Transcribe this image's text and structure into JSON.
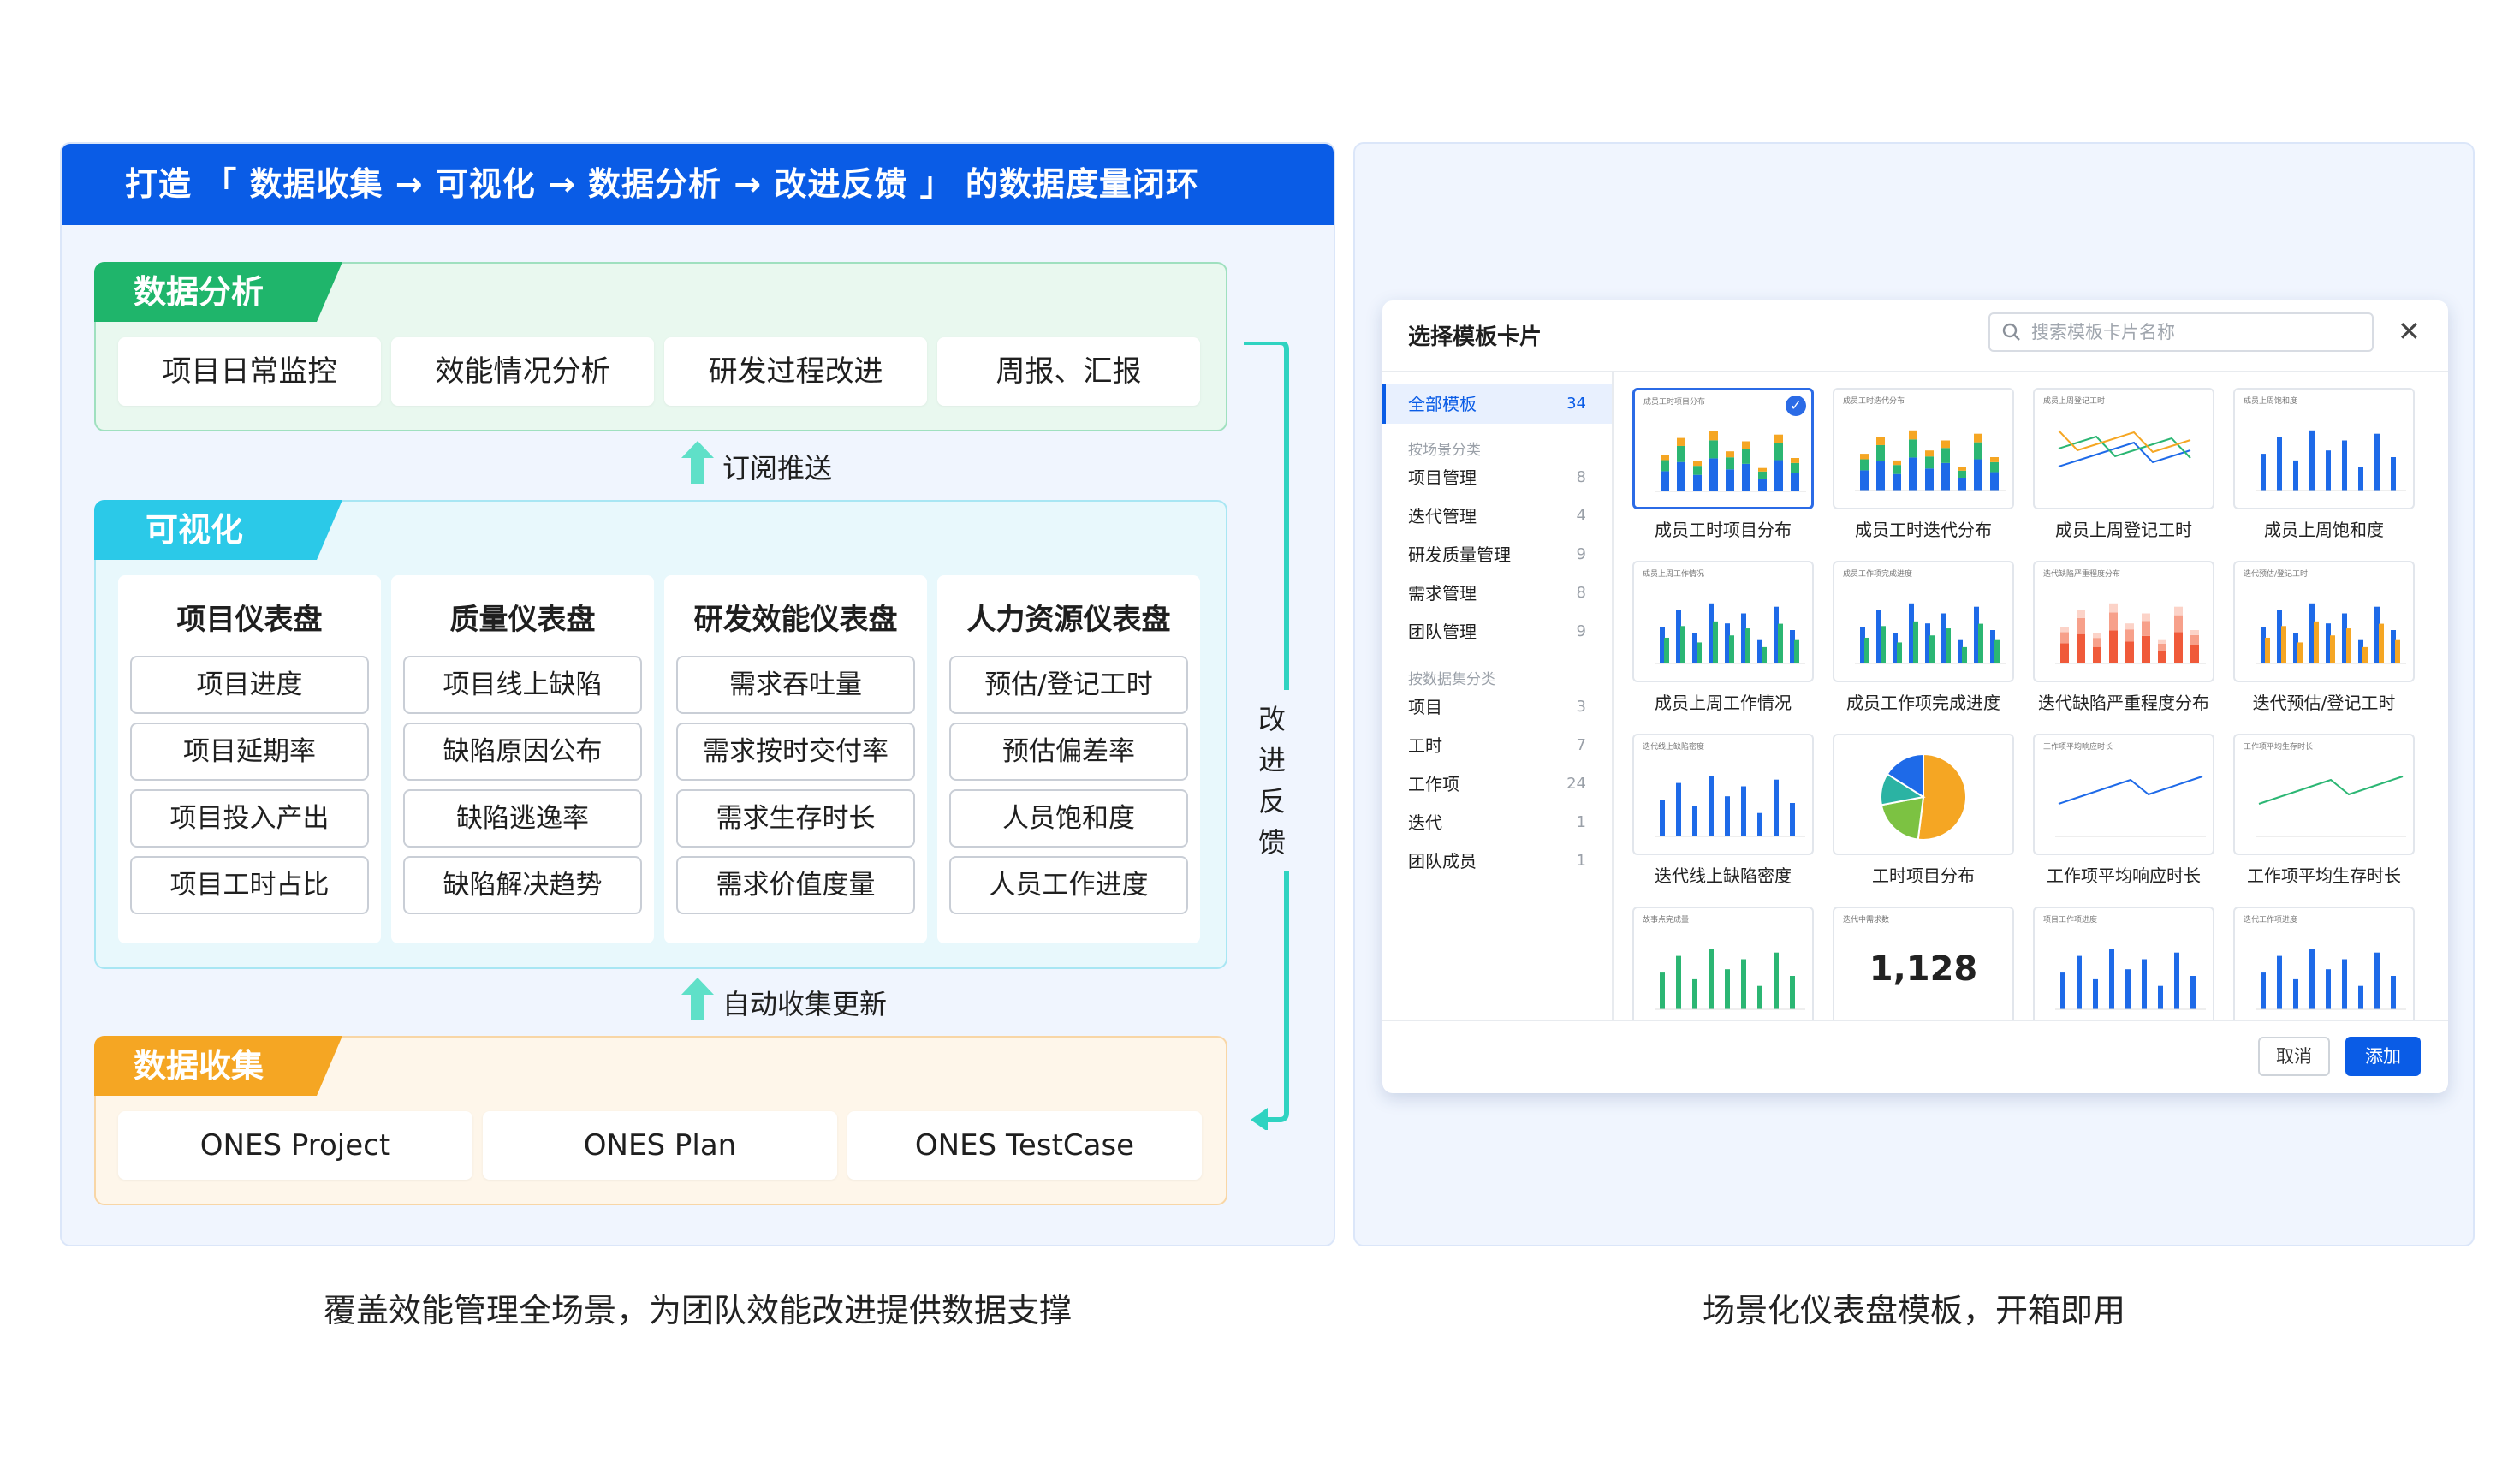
{
  "left": {
    "banner": "打造 「 数据收集 → 可视化 → 数据分析 → 改进反馈 」 的数据度量闭环",
    "analysis": {
      "tag": "数据分析",
      "items": [
        "项目日常监控",
        "效能情况分析",
        "研发过程改进",
        "周报、汇报"
      ]
    },
    "subscribe_label": "订阅推送",
    "visual": {
      "tag": "可视化",
      "cards": [
        {
          "title": "项目仪表盘",
          "items": [
            "项目进度",
            "项目延期率",
            "项目投入产出",
            "项目工时占比"
          ]
        },
        {
          "title": "质量仪表盘",
          "items": [
            "项目线上缺陷",
            "缺陷原因公布",
            "缺陷逃逸率",
            "缺陷解决趋势"
          ]
        },
        {
          "title": "研发效能仪表盘",
          "items": [
            "需求吞吐量",
            "需求按时交付率",
            "需求生存时长",
            "需求价值度量"
          ]
        },
        {
          "title": "人力资源仪表盘",
          "items": [
            "预估/登记工时",
            "预估偏差率",
            "人员饱和度",
            "人员工作进度"
          ]
        }
      ]
    },
    "auto_label": "自动收集更新",
    "collect": {
      "tag": "数据收集",
      "items": [
        "ONES Project",
        "ONES Plan",
        "ONES TestCase"
      ]
    },
    "loop_label_1": "改进",
    "loop_label_2": "反馈"
  },
  "dialog": {
    "title": "选择模板卡片",
    "search_placeholder": "搜索模板卡片名称",
    "close": "✕",
    "sidebar": {
      "all": {
        "label": "全部模板",
        "count": "34"
      },
      "group1": "按场景分类",
      "scene": [
        {
          "label": "项目管理",
          "count": "8"
        },
        {
          "label": "迭代管理",
          "count": "4"
        },
        {
          "label": "研发质量管理",
          "count": "9"
        },
        {
          "label": "需求管理",
          "count": "8"
        },
        {
          "label": "团队管理",
          "count": "9"
        }
      ],
      "group2": "按数据集分类",
      "dataset": [
        {
          "label": "项目",
          "count": "3"
        },
        {
          "label": "工时",
          "count": "7"
        },
        {
          "label": "工作项",
          "count": "24"
        },
        {
          "label": "迭代",
          "count": "1"
        },
        {
          "label": "团队成员",
          "count": "1"
        }
      ]
    },
    "tiles": [
      {
        "name": "成员工时项目分布",
        "kind": "stack",
        "mini": "成员工时项目分布"
      },
      {
        "name": "成员工时迭代分布",
        "kind": "stack",
        "mini": "成员工时迭代分布"
      },
      {
        "name": "成员上周登记工时",
        "kind": "lines",
        "mini": "成员上周登记工时"
      },
      {
        "name": "成员上周饱和度",
        "kind": "blue",
        "mini": "成员上周饱和度"
      },
      {
        "name": "成员上周工作情况",
        "kind": "bluegreen",
        "mini": "成员上周工作情况"
      },
      {
        "name": "成员工作项完成进度",
        "kind": "bluegreen2",
        "mini": "成员工作项完成进度"
      },
      {
        "name": "迭代缺陷严重程度分布",
        "kind": "red",
        "mini": "迭代缺陷严重程度分布"
      },
      {
        "name": "迭代预估/登记工时",
        "kind": "blueorange",
        "mini": "迭代预估/登记工时"
      },
      {
        "name": "迭代线上缺陷密度",
        "kind": "blue2",
        "mini": "迭代线上缺陷密度"
      },
      {
        "name": "工时项目分布",
        "kind": "pie",
        "mini": ""
      },
      {
        "name": "工作项平均响应时长",
        "kind": "line_blue",
        "mini": "工作项平均响应时长"
      },
      {
        "name": "工作项平均生存时长",
        "kind": "line_green",
        "mini": "工作项平均生存时长"
      },
      {
        "name": "",
        "kind": "green",
        "mini": "故事点完成量"
      },
      {
        "name": "",
        "kind": "number",
        "mini": "迭代中需求数",
        "value": "1,128"
      },
      {
        "name": "",
        "kind": "blue3",
        "mini": "项目工作项进度"
      },
      {
        "name": "",
        "kind": "blue4",
        "mini": "迭代工作项进度"
      }
    ],
    "cancel": "取消",
    "add": "添加"
  },
  "captions": {
    "left": "覆盖效能管理全场景，为团队效能改进提供数据支撑",
    "right": "场景化仪表盘模板，开箱即用"
  },
  "colors": {
    "brand": "#0a5ce6",
    "analysis": "#1fb56b",
    "visual": "#2bc9e8",
    "collect": "#f5a623",
    "loop": "#2fd3c1"
  }
}
